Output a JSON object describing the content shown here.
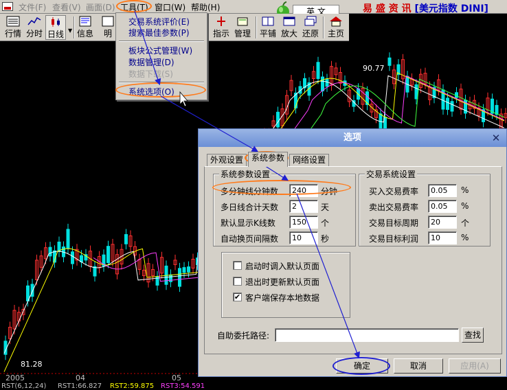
{
  "menubar": {
    "items": [
      "文件(F)",
      "查看(V)",
      "画面(D)",
      "工具(T)",
      "窗口(W)",
      "帮助(H)"
    ],
    "lang_label": "英 文",
    "brand_a": "易 盛 资 讯 ",
    "brand_b": "[美元指数 DINI]"
  },
  "toolbar": {
    "buttons": [
      "行情",
      "分时",
      "日线",
      "信息",
      "明细",
      "指示",
      "管理",
      "平铺",
      "放大",
      "还原",
      "主页"
    ]
  },
  "dropdown": {
    "items": [
      "交易系统评价(E)",
      "搜索最佳参数(P)",
      "板块公式管理(W)",
      "数据管理(D)",
      "数据下载(S)",
      "系统选项(O)"
    ]
  },
  "chart": {
    "high_label": "90.77",
    "low_label": "81.28",
    "x_labels": [
      "2005",
      "04",
      "05"
    ],
    "status_items": [
      {
        "text": "RST(6,12,24)",
        "color": "#c0c0c0"
      },
      {
        "text": "RST1:66.827",
        "color": "#c0c0c0"
      },
      {
        "text": "RST2:59.875",
        "color": "#ffff00"
      },
      {
        "text": "RST3:54.591",
        "color": "#ff00ff"
      }
    ],
    "colors": {
      "up": "#ff3030",
      "down": "#00e0e0",
      "ma1": "#ffffff",
      "ma2": "#ffff00",
      "ma3": "#ff40ff",
      "ma4": "#40ff40"
    }
  },
  "dialog": {
    "title": "选项",
    "tabs": [
      "外观设置",
      "系统参数",
      "网络设置"
    ],
    "group1_title": "系统参数设置",
    "group1_rows": [
      {
        "label": "多分钟线分钟数",
        "value": "240",
        "unit": "分钟"
      },
      {
        "label": "多日线合计天数",
        "value": "2",
        "unit": "天"
      },
      {
        "label": "默认显示K线数",
        "value": "150",
        "unit": "个"
      },
      {
        "label": "自动换页间隔数",
        "value": "10",
        "unit": "秒"
      }
    ],
    "group2_title": "交易系统设置",
    "group2_rows": [
      {
        "label": "买入交易费率",
        "value": "0.05",
        "unit": "%"
      },
      {
        "label": "卖出交易费率",
        "value": "0.05",
        "unit": "%"
      },
      {
        "label": "交易目标周期",
        "value": "20",
        "unit": "个"
      },
      {
        "label": "交易目标利润",
        "value": "10",
        "unit": "%"
      }
    ],
    "checkboxes": [
      {
        "label": "启动时调入默认页面",
        "checked": false,
        "mark": ""
      },
      {
        "label": "退出时更新默认页面",
        "checked": false,
        "mark": ""
      },
      {
        "label": "客户端保存本地数据",
        "checked": true,
        "mark": "✔"
      }
    ],
    "path_label": "自助委托路径:",
    "path_value": "",
    "browse_label": "查找",
    "ok_label": "确定",
    "cancel_label": "取消",
    "apply_label": "应用(A)"
  }
}
